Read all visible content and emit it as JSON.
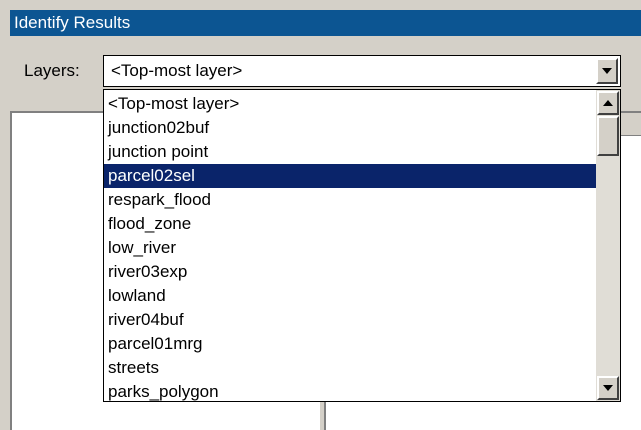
{
  "window": {
    "title": "Identify Results"
  },
  "layers": {
    "label": "Layers:",
    "selected": "<Top-most layer>",
    "options": [
      "<Top-most layer>",
      "junction02buf",
      "junction point",
      "parcel02sel",
      "respark_flood",
      "flood_zone",
      "low_river",
      "river03exp",
      "lowland",
      "river04buf",
      "parcel01mrg",
      "streets",
      "parks_polygon"
    ],
    "highlighted": "parcel02sel"
  },
  "colors": {
    "title_bar": "#0c5592",
    "highlight": "#0a246a",
    "face": "#d4d0c8"
  }
}
